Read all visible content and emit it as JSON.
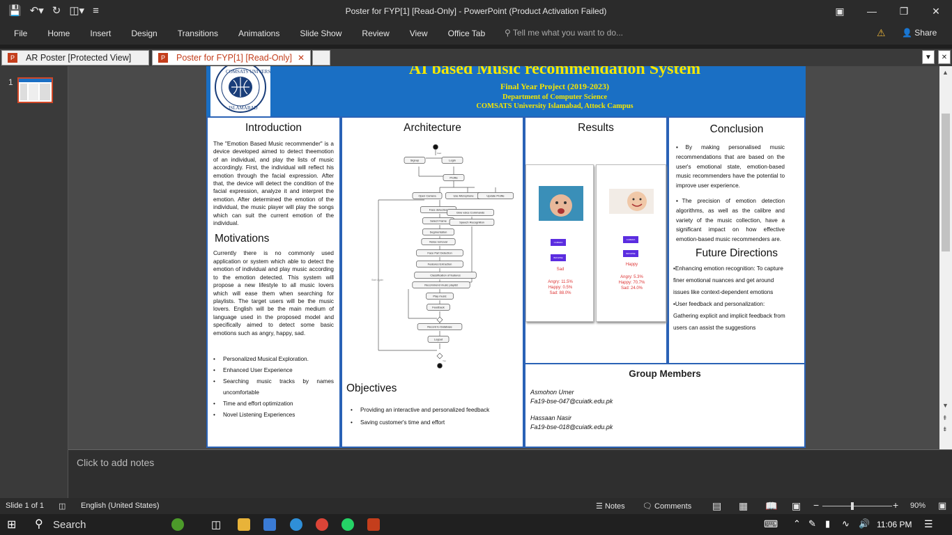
{
  "window": {
    "title": "Poster for FYP[1] [Read-Only] - PowerPoint (Product Activation Failed)"
  },
  "ribbon": {
    "tabs": [
      "File",
      "Home",
      "Insert",
      "Design",
      "Transitions",
      "Animations",
      "Slide Show",
      "Review",
      "View",
      "Office Tab"
    ],
    "tell_me": "Tell me what you want to do...",
    "share": "Share"
  },
  "doc_tabs": [
    {
      "label": "AR Poster [Protected View]"
    },
    {
      "label": "Poster for FYP[1] [Read-Only]"
    }
  ],
  "thumb": {
    "number": "1"
  },
  "poster": {
    "title": "AI based Music recommendation System",
    "subtitle": "Final Year Project (2019-2023)",
    "dept": "Department of Computer Science",
    "uni": "COMSATS University Islamabad, Attock Campus",
    "logo_text_top": "COMSATS UNIVERSITY",
    "logo_text_bottom": "ISLAMABAD",
    "intro_title": "Introduction",
    "intro_text": "The \"Emotion Based Music recommender\" is a device developed aimed to detect theemotion of an individual, and play the lists of music accordingly. First, the individual will reflect his emotion through the facial expression. After that, the device will detect the condition of the facial expression, analyze it and interpret the emotion. After determined the emotion of the individual, the music player will play the songs which can suit the current emotion of the individual.",
    "motiv_title": "Motivations",
    "motiv_text": "Currently there is no commonly used application or system which able to detect the emotion of individual and play music according to the emotion detected. This system will propose a new lifestyle to all music lovers which will ease them when searching for playlists. The target users will be the music lovers. English will be the main medium of language used in the proposed model and specifically aimed to detect some basic emotions such as angry, happy, sad.",
    "motiv_bullets": [
      "Personalized Musical Exploration.",
      "Enhanced User Experience",
      "Searching music tracks by names uncomfortable",
      "Time and effort optimization",
      "Novel Listening Experiences"
    ],
    "arch_title": "Architecture",
    "arch_nodes": [
      "Signup",
      "Login",
      "Profile",
      "Open Camera",
      "Use Microphone",
      "Update Profile",
      "Face detection",
      "Give voice Commands",
      "Select Frame",
      "Speech Recognition",
      "Segmentation",
      "Noise removal",
      "Face Part Detection",
      "Features Extraction",
      "Classification of features",
      "Recommend music playlist",
      "Play music",
      "Feedback",
      "Record to Database",
      "Logout"
    ],
    "arch_start_label": "Start",
    "arch_again_label": "Start Again",
    "arch_yes_label": "Yes",
    "objectives_title": "Objectives",
    "objectives": [
      "Providing an interactive and personalized feedback",
      "Saving customer's time and effort"
    ],
    "results_title": "Results",
    "results": [
      {
        "btn1": "CAMERA",
        "btn2": "BROWSE",
        "emotion": "Sad",
        "scores": [
          "Angry: 11.5%",
          "Happy: 0.5%",
          "Sad: 88.0%"
        ]
      },
      {
        "btn1": "CAMERA",
        "btn2": "BROWSE",
        "emotion": "Happy",
        "scores": [
          "Angry: 5.3%",
          "Happy: 70.7%",
          "Sad: 24.0%"
        ]
      }
    ],
    "conclusion_title": "Conclusion",
    "conclusion": [
      "By making personalised music recommendations that are based on the user's emotional state, emotion-based music recommenders have the potential to improve user experience.",
      "The precision of emotion detection algorithms, as well as the calibre and variety of the music collection, have a significant impact on how effective emotion-based music recommenders are."
    ],
    "future_title": "Future Directions",
    "future": [
      "Enhancing emotion recognition: To capture finer emotional nuances and get around issues like context-dependent emotions",
      "User feedback and personalization: Gathering explicit and implicit feedback from users can assist the suggestions"
    ],
    "group_title": "Group Members",
    "members": [
      {
        "name": "Asmohon Umer",
        "email": "Fa19-bse-047@cuiatk.edu.pk"
      },
      {
        "name": "Hassaan Nasir",
        "email": "Fa19-bse-018@cuiatk.edu.pk"
      }
    ]
  },
  "notes_placeholder": "Click to add notes",
  "status": {
    "slide": "Slide 1 of 1",
    "language": "English (United States)",
    "notes": "Notes",
    "comments": "Comments",
    "zoom": "90%"
  },
  "taskbar": {
    "search": "Search",
    "time": "11:06 PM"
  },
  "colors": {
    "poster_header": "#1a6fc4",
    "poster_title": "#f5e600",
    "panel_border": "#2a62b6",
    "powerpoint": "#c43e1c"
  }
}
